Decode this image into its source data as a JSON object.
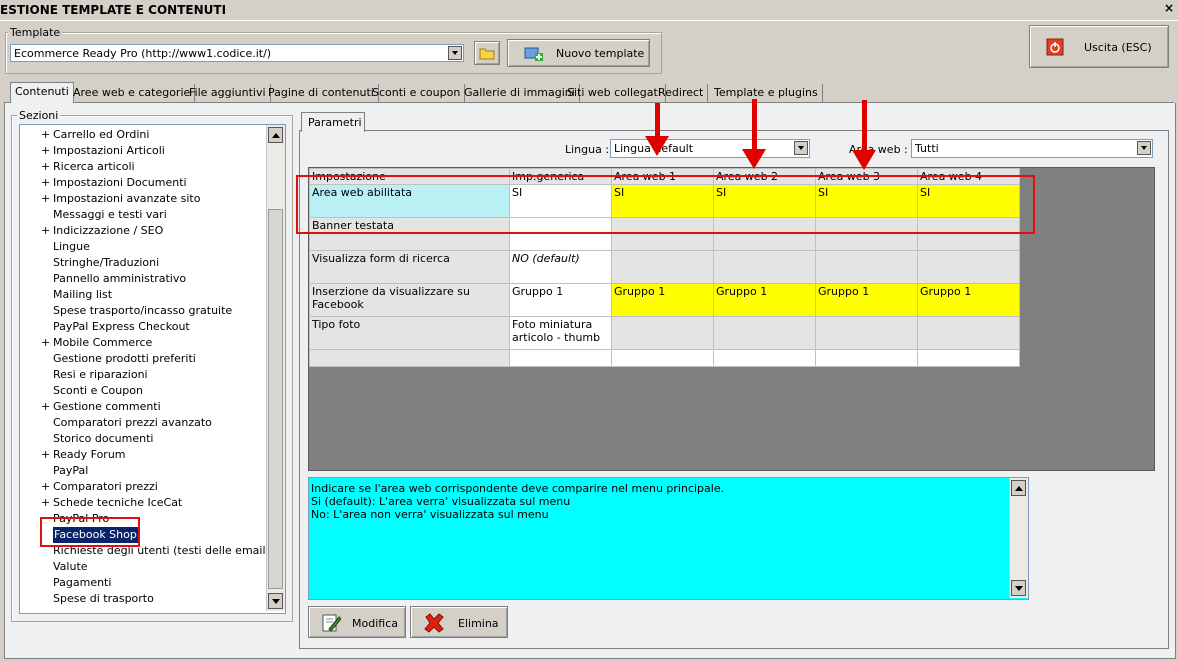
{
  "window": {
    "title": "ESTIONE TEMPLATE E CONTENUTI",
    "close": "×"
  },
  "template": {
    "legend": "Template",
    "value": "Ecommerce Ready Pro (http://www1.codice.it/)",
    "new_label": "Nuovo template"
  },
  "exit": {
    "label": "Uscita (ESC)"
  },
  "tabs": [
    "Contenuti",
    "Aree web e categorie",
    "File aggiuntivi",
    "Pagine di contenuti",
    "Sconti e coupon",
    "Gallerie di immagini",
    "Siti web collegati",
    "Redirect",
    "Template e plugins"
  ],
  "sections": {
    "legend": "Sezioni",
    "items": [
      {
        "label": "Carrello ed Ordini",
        "plus": "+"
      },
      {
        "label": "Impostazioni Articoli",
        "plus": "+"
      },
      {
        "label": "Ricerca articoli",
        "plus": "+"
      },
      {
        "label": "Impostazioni Documenti",
        "plus": "+"
      },
      {
        "label": "Impostazioni avanzate sito",
        "plus": "+"
      },
      {
        "label": "Messaggi e testi vari",
        "plus": ""
      },
      {
        "label": "Indicizzazione / SEO",
        "plus": "+"
      },
      {
        "label": "Lingue",
        "plus": ""
      },
      {
        "label": "Stringhe/Traduzioni",
        "plus": ""
      },
      {
        "label": "Pannello amministrativo",
        "plus": ""
      },
      {
        "label": "Mailing list",
        "plus": ""
      },
      {
        "label": "Spese trasporto/incasso gratuite",
        "plus": ""
      },
      {
        "label": "PayPal Express Checkout",
        "plus": ""
      },
      {
        "label": "Mobile Commerce",
        "plus": "+"
      },
      {
        "label": "Gestione prodotti preferiti",
        "plus": ""
      },
      {
        "label": "Resi e riparazioni",
        "plus": ""
      },
      {
        "label": "Sconti e Coupon",
        "plus": ""
      },
      {
        "label": "Gestione commenti",
        "plus": "+"
      },
      {
        "label": "Comparatori prezzi avanzato",
        "plus": ""
      },
      {
        "label": "Storico documenti",
        "plus": ""
      },
      {
        "label": "Ready Forum",
        "plus": "+"
      },
      {
        "label": "PayPal",
        "plus": ""
      },
      {
        "label": "Comparatori prezzi",
        "plus": "+"
      },
      {
        "label": "Schede tecniche IceCat",
        "plus": "+"
      },
      {
        "label": "PayPal Pro",
        "plus": ""
      },
      {
        "label": "Facebook Shop",
        "plus": "",
        "selected": true
      },
      {
        "label": "Richieste degli utenti (testi delle email)",
        "plus": ""
      },
      {
        "label": "Valute",
        "plus": ""
      },
      {
        "label": "Pagamenti",
        "plus": ""
      },
      {
        "label": "Spese di trasporto",
        "plus": ""
      }
    ]
  },
  "params": {
    "tab": "Parametri",
    "lingua_label": "Lingua :",
    "lingua_value": "Lingua default",
    "area_label": "Area web :",
    "area_value": "Tutti"
  },
  "grid": {
    "headers": [
      "Impostazione",
      "Imp.generica",
      "Area web 1",
      "Area web 2",
      "Area web 3",
      "Area web 4"
    ],
    "rows": [
      {
        "name": "Area web abilitata",
        "generic": "SI",
        "areas": [
          "SI",
          "SI",
          "SI",
          "SI"
        ],
        "style": "yel"
      },
      {
        "name": "Banner testata",
        "generic": "",
        "areas": [
          "",
          "",
          "",
          ""
        ],
        "style": "gry"
      },
      {
        "name": "Visualizza form di ricerca",
        "generic": "NO (default)",
        "areas": [
          "",
          "",
          "",
          ""
        ],
        "style": "gry",
        "italic": true
      },
      {
        "name": "Inserzione da visualizzare su Facebook",
        "generic": "Gruppo 1",
        "areas": [
          "Gruppo 1",
          "Gruppo 1",
          "Gruppo 1",
          "Gruppo 1"
        ],
        "style": "yel"
      },
      {
        "name": "Tipo foto",
        "generic": "Foto miniatura articolo - thumb",
        "areas": [
          "",
          "",
          "",
          ""
        ],
        "style": "gry"
      },
      {
        "name": "",
        "generic": "",
        "areas": [
          "",
          "",
          "",
          ""
        ],
        "style": "wht"
      }
    ]
  },
  "description": {
    "lines": [
      "Indicare se l'area web corrispondente deve comparire nel menu principale.",
      "Si (default): L'area verra' visualizzata sul menu",
      "No: L'area non verra' visualizzata sul menu"
    ]
  },
  "actions": {
    "edit_label": "Modifica",
    "delete_label": "Elimina"
  },
  "colors": {
    "highlight_yellow": "#ffff00",
    "desc_cyan": "#00ffff",
    "annotation_red": "#e00000"
  }
}
